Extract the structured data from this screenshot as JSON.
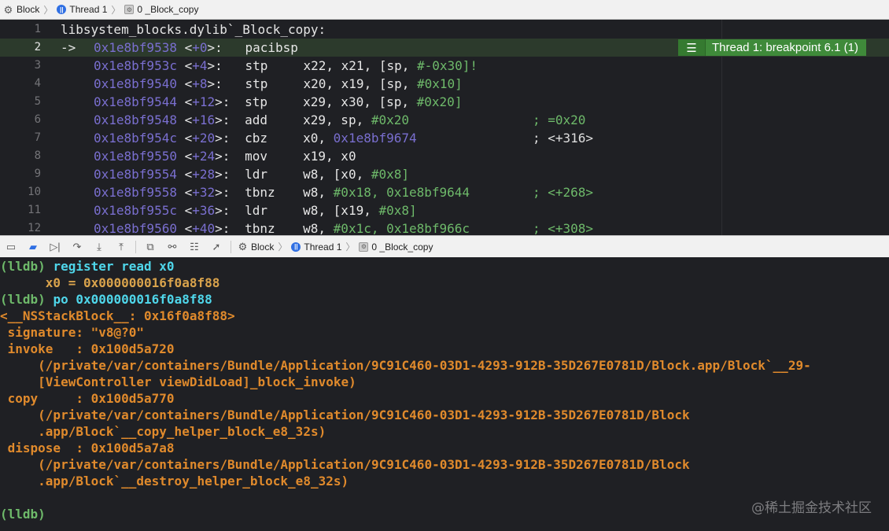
{
  "top_jumpbar": {
    "items": [
      "Block",
      "Thread 1",
      "0 _Block_copy"
    ]
  },
  "editor": {
    "header_line_number": "1",
    "header_text": "libsystem_blocks.dylib`_Block_copy:",
    "breakpoint_badge": "Thread 1: breakpoint 6.1 (1)",
    "lines": [
      {
        "n": "2",
        "arrow": "->",
        "addr": "0x1e8bf9538",
        "off": "+0",
        "op": "pacibsp",
        "args": [],
        "cmt": ""
      },
      {
        "n": "3",
        "arrow": "",
        "addr": "0x1e8bf953c",
        "off": "+4",
        "op": "stp",
        "args": [
          [
            "x22, x21, [sp, ",
            "p"
          ],
          [
            "#-0x30",
            "n"
          ],
          [
            "]!",
            "n"
          ]
        ],
        "cmt": ""
      },
      {
        "n": "4",
        "arrow": "",
        "addr": "0x1e8bf9540",
        "off": "+8",
        "op": "stp",
        "args": [
          [
            "x20, x19, [sp, ",
            "p"
          ],
          [
            "#0x10",
            "n"
          ],
          [
            "]",
            "n"
          ]
        ],
        "cmt": ""
      },
      {
        "n": "5",
        "arrow": "",
        "addr": "0x1e8bf9544",
        "off": "+12",
        "op": "stp",
        "args": [
          [
            "x29, x30, [sp, ",
            "p"
          ],
          [
            "#0x20",
            "n"
          ],
          [
            "]",
            "n"
          ]
        ],
        "cmt": ""
      },
      {
        "n": "6",
        "arrow": "",
        "addr": "0x1e8bf9548",
        "off": "+16",
        "op": "add",
        "args": [
          [
            "x29, sp, ",
            "p"
          ],
          [
            "#0x20",
            "n"
          ]
        ],
        "cmt": "; =0x20",
        "cmt_color": "n"
      },
      {
        "n": "7",
        "arrow": "",
        "addr": "0x1e8bf954c",
        "off": "+20",
        "op": "cbz",
        "args": [
          [
            "x0, ",
            "p"
          ],
          [
            "0x1e8bf9674",
            "a"
          ]
        ],
        "cmt": "; <+316>",
        "cmt_color": "p"
      },
      {
        "n": "8",
        "arrow": "",
        "addr": "0x1e8bf9550",
        "off": "+24",
        "op": "mov",
        "args": [
          [
            "x19, x0",
            "p"
          ]
        ],
        "cmt": ""
      },
      {
        "n": "9",
        "arrow": "",
        "addr": "0x1e8bf9554",
        "off": "+28",
        "op": "ldr",
        "args": [
          [
            "w8, [x0, ",
            "p"
          ],
          [
            "#0x8",
            "n"
          ],
          [
            "]",
            "n"
          ]
        ],
        "cmt": ""
      },
      {
        "n": "10",
        "arrow": "",
        "addr": "0x1e8bf9558",
        "off": "+32",
        "op": "tbnz",
        "args": [
          [
            "w8, ",
            "p"
          ],
          [
            "#0x18, 0x1e8bf9644",
            "n"
          ]
        ],
        "cmt": "; <+268>",
        "cmt_color": "n"
      },
      {
        "n": "11",
        "arrow": "",
        "addr": "0x1e8bf955c",
        "off": "+36",
        "op": "ldr",
        "args": [
          [
            "w8, [x19, ",
            "p"
          ],
          [
            "#0x8",
            "n"
          ],
          [
            "]",
            "n"
          ]
        ],
        "cmt": ""
      },
      {
        "n": "12",
        "arrow": "",
        "addr": "0x1e8bf9560",
        "off": "+40",
        "op": "tbnz",
        "args": [
          [
            "w8, ",
            "p"
          ],
          [
            "#0x1c, 0x1e8bf966c",
            "n"
          ]
        ],
        "cmt": "; <+308>",
        "cmt_color": "n"
      }
    ]
  },
  "debug_bar": {
    "items": [
      "Block",
      "Thread 1",
      "0 _Block_copy"
    ]
  },
  "console": {
    "lines": [
      [
        [
          "(lldb) ",
          "prompt"
        ],
        [
          "register read x0",
          "cmd"
        ]
      ],
      [
        [
          "      x0 = 0x000000016f0a8f88",
          "out"
        ]
      ],
      [
        [
          "(lldb) ",
          "prompt"
        ],
        [
          "po 0x000000016f0a8f88",
          "cmd"
        ]
      ],
      [
        [
          "<__NSStackBlock__: 0x16f0a8f88>",
          "res"
        ]
      ],
      [
        [
          " signature: \"v8@?0\"",
          "res"
        ]
      ],
      [
        [
          " invoke   : 0x100d5a720",
          "res"
        ]
      ],
      [
        [
          "     (/private/var/containers/Bundle/Application/9C91C460-03D1-4293-912B-35D267E0781D/Block.app/Block`__29-",
          "res"
        ]
      ],
      [
        [
          "     [ViewController viewDidLoad]_block_invoke)",
          "res"
        ]
      ],
      [
        [
          " copy     : 0x100d5a770",
          "res"
        ]
      ],
      [
        [
          "     (/private/var/containers/Bundle/Application/9C91C460-03D1-4293-912B-35D267E0781D/Block",
          "res"
        ]
      ],
      [
        [
          "     .app/Block`__copy_helper_block_e8_32s)",
          "res"
        ]
      ],
      [
        [
          " dispose  : 0x100d5a7a8",
          "res"
        ]
      ],
      [
        [
          "     (/private/var/containers/Bundle/Application/9C91C460-03D1-4293-912B-35D267E0781D/Block",
          "res"
        ]
      ],
      [
        [
          "     .app/Block`__destroy_helper_block_e8_32s)",
          "res"
        ]
      ],
      [
        [
          "",
          "res"
        ]
      ],
      [
        [
          "(lldb)",
          "prompt"
        ]
      ]
    ],
    "watermark": "@稀土掘金技术社区"
  }
}
